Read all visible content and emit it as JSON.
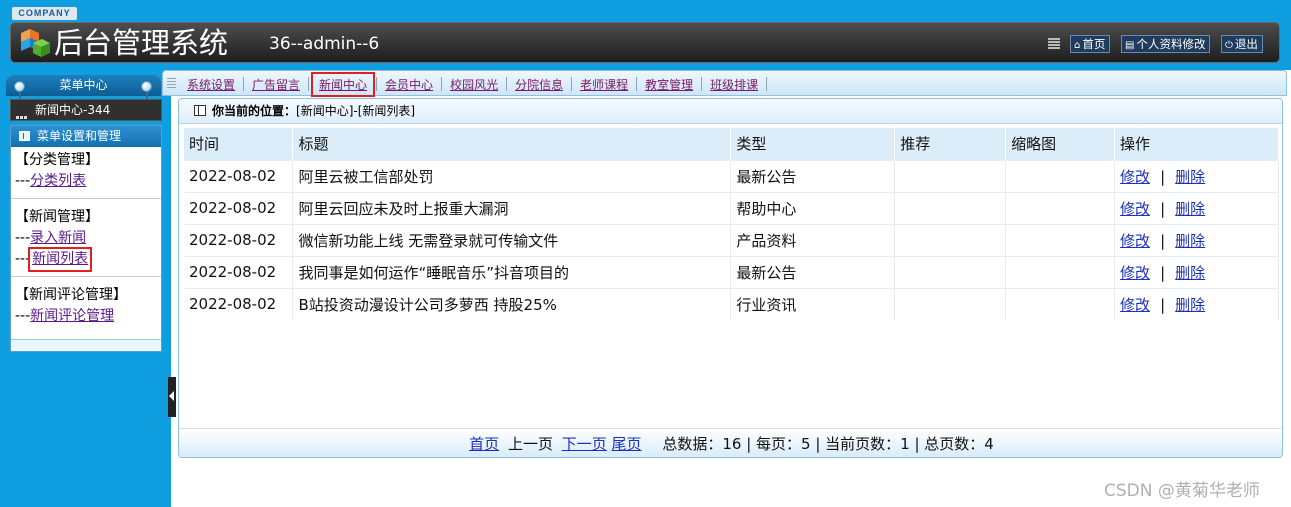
{
  "header": {
    "company": "COMPANY",
    "system_title": "后台管理系统",
    "user_info": "36--admin--6",
    "buttons": [
      {
        "icon": "home-icon",
        "label": "首页"
      },
      {
        "icon": "profile-icon",
        "label": "个人资料修改"
      },
      {
        "icon": "power-icon",
        "label": "退出"
      }
    ]
  },
  "sidebar": {
    "menu_center": "菜单中心",
    "current_module": "新闻中心-344",
    "panel_title": "菜单设置和管理",
    "groups": [
      {
        "title": "【分类管理】",
        "items": [
          {
            "prefix": "---",
            "label": "分类列表"
          }
        ]
      },
      {
        "title": "【新闻管理】",
        "items": [
          {
            "prefix": "---",
            "label": "录入新闻"
          },
          {
            "prefix": "---",
            "label": "新闻列表"
          }
        ]
      },
      {
        "title": "【新闻评论管理】",
        "items": [
          {
            "prefix": "---",
            "label": "新闻评论管理"
          }
        ]
      }
    ]
  },
  "nav": {
    "items": [
      "系统设置",
      "广告留言",
      "新闻中心",
      "会员中心",
      "校园风光",
      "分院信息",
      "老师课程",
      "教室管理",
      "班级排课"
    ],
    "active": "新闻中心"
  },
  "breadcrumb": {
    "label": "你当前的位置：",
    "path": "[新闻中心]-[新闻列表]"
  },
  "table": {
    "columns": [
      "时间",
      "标题",
      "类型",
      "推荐",
      "缩略图",
      "操作"
    ],
    "rows": [
      {
        "time": "2022-08-02",
        "title": "阿里云被工信部处罚",
        "type": "最新公告",
        "recommend": "",
        "thumb": ""
      },
      {
        "time": "2022-08-02",
        "title": "阿里云回应未及时上报重大漏洞",
        "type": "帮助中心",
        "recommend": "",
        "thumb": ""
      },
      {
        "time": "2022-08-02",
        "title": "微信新功能上线 无需登录就可传输文件",
        "type": "产品资料",
        "recommend": "",
        "thumb": ""
      },
      {
        "time": "2022-08-02",
        "title": "我同事是如何运作“睡眠音乐”抖音项目的",
        "type": "最新公告",
        "recommend": "",
        "thumb": ""
      },
      {
        "time": "2022-08-02",
        "title": "B站投资动漫设计公司多萝西 持股25%",
        "type": "行业资讯",
        "recommend": "",
        "thumb": ""
      }
    ],
    "action_edit": "修改",
    "action_sep": "|",
    "action_delete": "删除"
  },
  "pager": {
    "first": "首页",
    "prev": "上一页",
    "next": "下一页",
    "last": "尾页",
    "stats": "总数据：16 | 每页：5 | 当前页数：1 | 总页数：4"
  },
  "watermark": "CSDN @黄菊华老师",
  "colors": {
    "brand_blue": "#0f9fe0",
    "highlight_red": "#e01f1f",
    "link_blue": "#1a30c0",
    "link_purple": "#5a1a8f"
  }
}
